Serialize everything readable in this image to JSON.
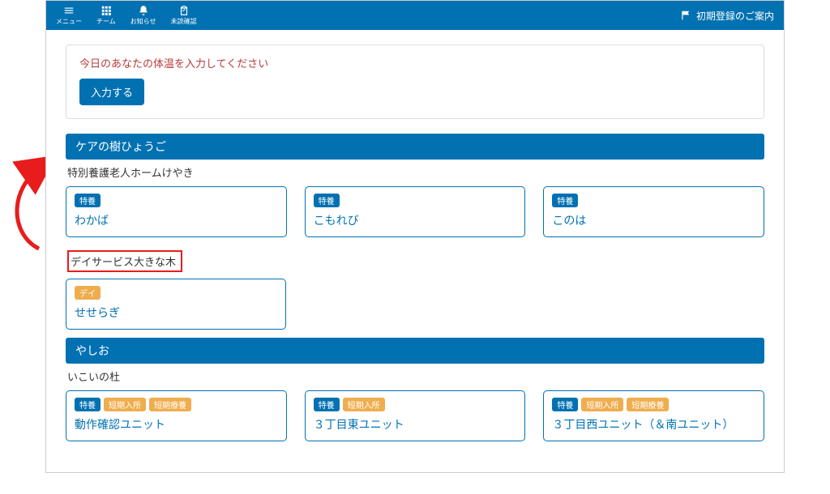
{
  "nav": {
    "menu": "メニュー",
    "team": "チーム",
    "notice": "お知らせ",
    "unread": "未読確認",
    "guide": "初期登録のご案内"
  },
  "alert": {
    "text": "今日のあなたの体温を入力してください",
    "button": "入力する"
  },
  "sections": [
    {
      "title": "ケアの樹ひょうご",
      "groups": [
        {
          "label": "特別養護老人ホームけやき",
          "highlight": false,
          "cards": [
            {
              "badges": [
                {
                  "text": "特養",
                  "color": "blue"
                }
              ],
              "title": "わかば"
            },
            {
              "badges": [
                {
                  "text": "特養",
                  "color": "blue"
                }
              ],
              "title": "こもれび"
            },
            {
              "badges": [
                {
                  "text": "特養",
                  "color": "blue"
                }
              ],
              "title": "このは"
            }
          ]
        },
        {
          "label": "デイサービス大きな木",
          "highlight": true,
          "cards": [
            {
              "badges": [
                {
                  "text": "デイ",
                  "color": "orange"
                }
              ],
              "title": "せせらぎ"
            }
          ]
        }
      ]
    },
    {
      "title": "やしお",
      "groups": [
        {
          "label": "いこいの杜",
          "highlight": false,
          "cards": [
            {
              "badges": [
                {
                  "text": "特養",
                  "color": "blue"
                },
                {
                  "text": "短期入所",
                  "color": "orange"
                },
                {
                  "text": "短期療養",
                  "color": "orange"
                }
              ],
              "title": "動作確認ユニット"
            },
            {
              "badges": [
                {
                  "text": "特養",
                  "color": "blue"
                },
                {
                  "text": "短期入所",
                  "color": "orange"
                }
              ],
              "title": "３丁目東ユニット"
            },
            {
              "badges": [
                {
                  "text": "特養",
                  "color": "blue"
                },
                {
                  "text": "短期入所",
                  "color": "orange"
                },
                {
                  "text": "短期療養",
                  "color": "orange"
                }
              ],
              "title": "３丁目西ユニット（＆南ユニット）"
            }
          ]
        }
      ]
    }
  ]
}
